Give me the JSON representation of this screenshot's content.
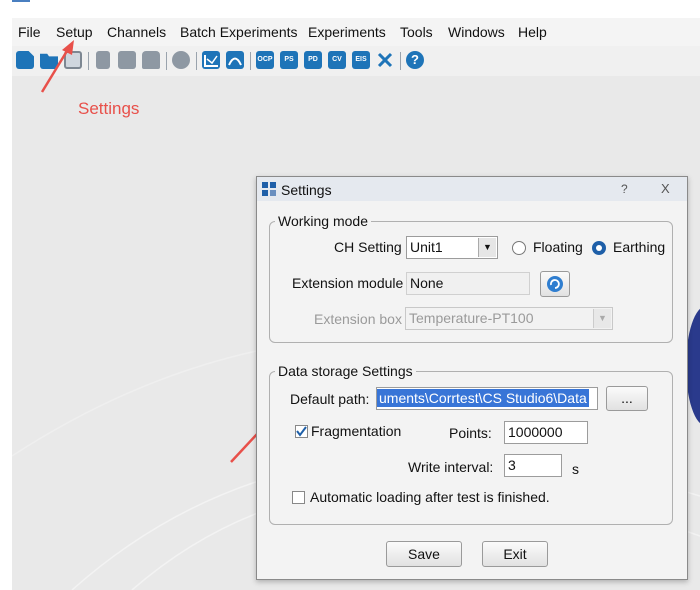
{
  "menu": {
    "file": "File",
    "setup": "Setup",
    "channels": "Channels",
    "batch_experiments": "Batch Experiments",
    "experiments": "Experiments",
    "tools": "Tools",
    "windows": "Windows",
    "help": "Help"
  },
  "toolbar": {
    "ocp": "OCP",
    "ps": "PS",
    "pd": "PD",
    "cv": "CV",
    "eis": "EIS",
    "help": "?"
  },
  "annotation": {
    "settings_label": "Settings"
  },
  "dialog": {
    "title": "Settings",
    "help_btn": "?",
    "close_btn": "X",
    "working_mode": {
      "title": "Working mode",
      "ch_setting_label": "CH Setting",
      "ch_setting_value": "Unit1",
      "floating": "Floating",
      "earthing": "Earthing",
      "selected": "Earthing",
      "extension_module_label": "Extension module",
      "extension_module_value": "None",
      "extension_box_label": "Extension box",
      "extension_box_value": "Temperature-PT100"
    },
    "data_storage": {
      "title": "Data storage Settings",
      "default_path_label": "Default path:",
      "default_path_value": "uments\\Corrtest\\CS Studio6\\Data",
      "browse": "...",
      "fragmentation_label": "Fragmentation",
      "fragmentation_checked": true,
      "points_label": "Points:",
      "points_value": "1000000",
      "write_interval_label": "Write interval:",
      "write_interval_value": "3",
      "write_interval_unit": "s",
      "auto_loading_label": "Automatic loading after test is finished.",
      "auto_loading_checked": false
    },
    "save": "Save",
    "exit": "Exit"
  },
  "colors": {
    "annotation": "#e8504a",
    "selection": "#3875d7",
    "toolbar_icon": "#1e74b8"
  }
}
